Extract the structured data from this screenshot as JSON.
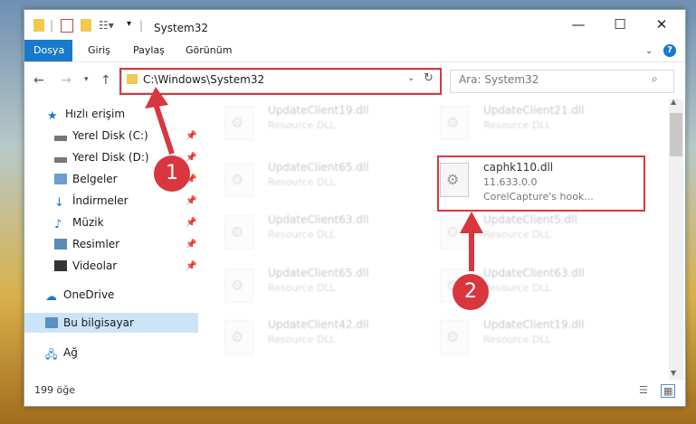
{
  "window": {
    "title": "System32",
    "controls": {
      "minimize": "—",
      "maximize": "☐",
      "close": "✕"
    }
  },
  "ribbon": {
    "tabs": [
      {
        "label": "Dosya",
        "active": true
      },
      {
        "label": "Giriş"
      },
      {
        "label": "Paylaş"
      },
      {
        "label": "Görünüm"
      }
    ]
  },
  "address": {
    "path": "C:\\Windows\\System32"
  },
  "search": {
    "placeholder": "Ara: System32"
  },
  "sidebar": {
    "items": [
      {
        "label": "Hızlı erişim",
        "icon": "star-icon"
      },
      {
        "label": "Yerel Disk (C:)",
        "icon": "drive-icon",
        "pinned": true
      },
      {
        "label": "Yerel Disk (D:)",
        "icon": "drive-icon",
        "pinned": true
      },
      {
        "label": "Belgeler",
        "icon": "documents-icon",
        "pinned": true
      },
      {
        "label": "İndirmeler",
        "icon": "downloads-icon",
        "pinned": true
      },
      {
        "label": "Müzik",
        "icon": "music-icon",
        "pinned": true
      },
      {
        "label": "Resimler",
        "icon": "pictures-icon",
        "pinned": true
      },
      {
        "label": "Videolar",
        "icon": "videos-icon",
        "pinned": true
      },
      {
        "label": "OneDrive",
        "icon": "cloud-icon"
      },
      {
        "label": "Bu bilgisayar",
        "icon": "computer-icon",
        "selected": true
      },
      {
        "label": "Ağ",
        "icon": "network-icon"
      }
    ]
  },
  "files": {
    "highlighted": {
      "name": "caphk110.dll",
      "version": "11.633.0.0",
      "description": "CorelCapture's hook..."
    },
    "faded": [
      {
        "name": "UpdateClient19.dll",
        "type": "Resource DLL"
      },
      {
        "name": "UpdateClient21.dll",
        "type": "Resource DLL"
      },
      {
        "name": "UpdateClient65.dll",
        "type": "Resource DLL"
      },
      {
        "name": "UpdateClient63.dll",
        "type": "Resource DLL"
      },
      {
        "name": "UpdateClient5.dll",
        "type": "Resource DLL"
      },
      {
        "name": "UpdateClient65.dll",
        "type": "Resource DLL"
      },
      {
        "name": "UpdateClient63.dll",
        "type": "Resource DLL"
      },
      {
        "name": "UpdateClient42.dll",
        "type": "Resource DLL"
      },
      {
        "name": "UpdateClient19.dll",
        "type": "Resource DLL"
      }
    ]
  },
  "status": {
    "count": "199 öğe"
  },
  "annotations": {
    "step1": "1",
    "step2": "2",
    "color": "#d9363e"
  }
}
